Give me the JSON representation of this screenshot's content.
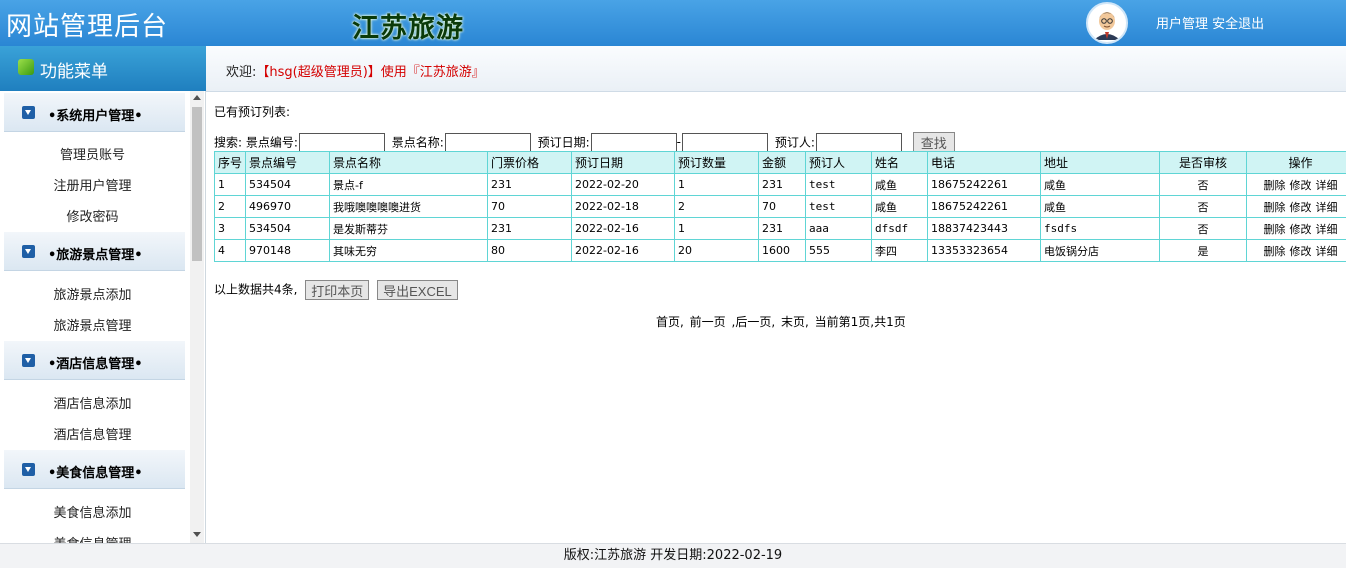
{
  "header": {
    "title": "网站管理后台",
    "site_name": "江苏旅游",
    "user_manage": "用户管理",
    "logout": "安全退出"
  },
  "sidebar": {
    "heading": "功能菜单",
    "groups": [
      {
        "title": "•系统用户管理•",
        "items": [
          "管理员账号",
          "注册用户管理",
          "修改密码"
        ]
      },
      {
        "title": "•旅游景点管理•",
        "items": [
          "旅游景点添加",
          "旅游景点管理"
        ]
      },
      {
        "title": "•酒店信息管理•",
        "items": [
          "酒店信息添加",
          "酒店信息管理"
        ]
      },
      {
        "title": "•美食信息管理•",
        "items": [
          "美食信息添加",
          "美食信息管理"
        ]
      }
    ]
  },
  "welcome": {
    "prefix": "欢迎:",
    "user": "【hsg(超级管理员)】使用『江苏旅游』"
  },
  "main": {
    "list_title": "已有预订列表:",
    "search": {
      "label": "搜索:",
      "spot_no": "景点编号:",
      "spot_name": "景点名称:",
      "date": "预订日期:",
      "date_sep": "-",
      "booker": "预订人:",
      "button": "查找"
    },
    "columns": [
      "序号",
      "景点编号",
      "景点名称",
      "门票价格",
      "预订日期",
      "预订数量",
      "金额",
      "预订人",
      "姓名",
      "电话",
      "地址",
      "是否审核",
      "操作"
    ],
    "rows": [
      [
        "1",
        "534504",
        "景点-f",
        "231",
        "2022-02-20",
        "1",
        "231",
        "test",
        "咸鱼",
        "18675242261",
        "咸鱼",
        "否"
      ],
      [
        "2",
        "496970",
        "我哦噢噢噢噢进货",
        "70",
        "2022-02-18",
        "2",
        "70",
        "test",
        "咸鱼",
        "18675242261",
        "咸鱼",
        "否"
      ],
      [
        "3",
        "534504",
        "是发斯蒂芬",
        "231",
        "2022-02-16",
        "1",
        "231",
        "aaa",
        "dfsdf",
        "18837423443",
        "fsdfs",
        "否"
      ],
      [
        "4",
        "970148",
        "其味无穷",
        "80",
        "2022-02-16",
        "20",
        "1600",
        "555",
        "李四",
        "13353323654",
        "电饭锅分店",
        "是"
      ]
    ],
    "actions": {
      "delete": "删除",
      "edit": "修改",
      "detail": "详细"
    },
    "summary": "以上数据共4条,",
    "print_button": "打印本页",
    "export_button": "导出EXCEL",
    "pager": {
      "first": "首页,",
      "prev": "前一页",
      "next": ",后一页,",
      "last": "末页,",
      "status": "当前第1页,共1页"
    }
  },
  "footer": {
    "copyright": "版权:江苏旅游 开发日期:2022-02-19"
  },
  "colors": {
    "header_blue": "#2a86d4",
    "table_header": "#d0f4f4",
    "table_border": "#5fd5d5",
    "welcome_red": "#d40000"
  }
}
